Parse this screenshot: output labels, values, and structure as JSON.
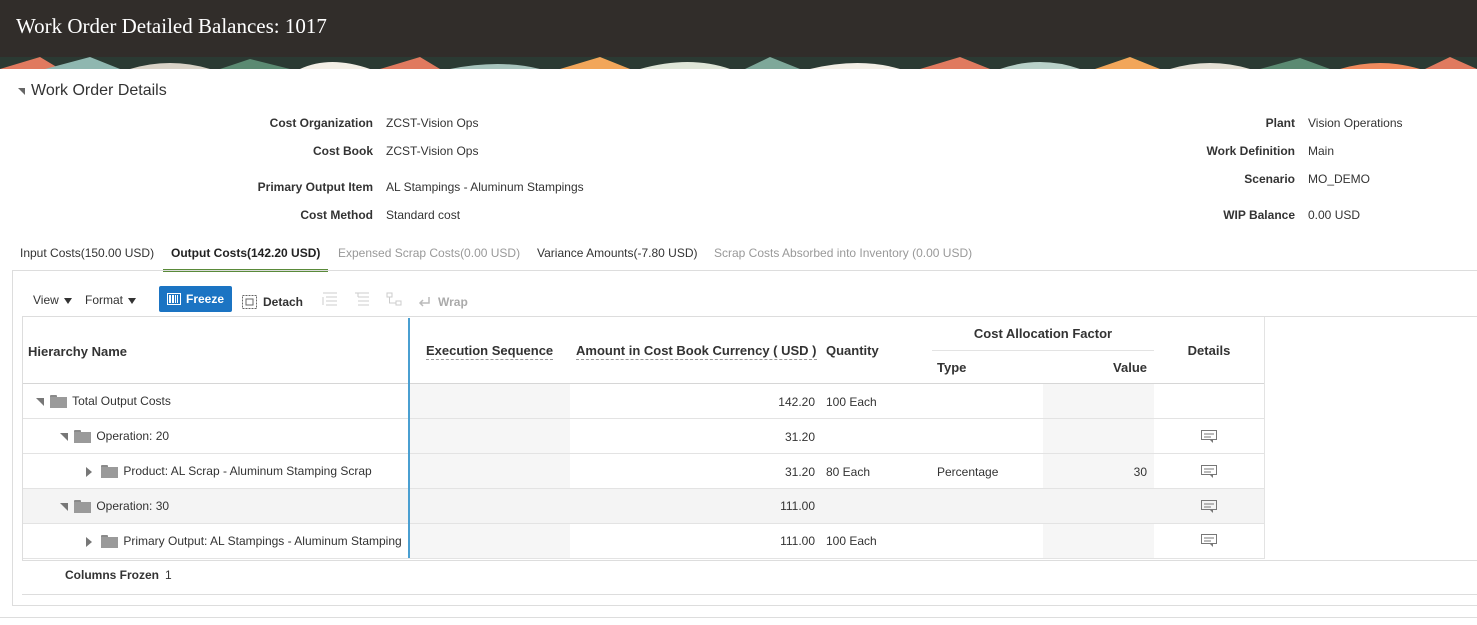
{
  "page": {
    "title": "Work Order Detailed Balances: 1017"
  },
  "section": {
    "title": "Work Order Details"
  },
  "details": {
    "cost_org_label": "Cost Organization",
    "cost_org_value": "ZCST-Vision Ops",
    "cost_book_label": "Cost Book",
    "cost_book_value": "ZCST-Vision Ops",
    "primary_output_label": "Primary Output Item",
    "primary_output_value": "AL Stampings - Aluminum Stampings",
    "cost_method_label": "Cost Method",
    "cost_method_value": "Standard cost",
    "plant_label": "Plant",
    "plant_value": "Vision Operations",
    "work_def_label": "Work Definition",
    "work_def_value": "Main",
    "scenario_label": "Scenario",
    "scenario_value": "MO_DEMO",
    "wip_label": "WIP Balance",
    "wip_value": "0.00 USD"
  },
  "tabs": [
    {
      "label": "Input Costs(150.00 USD)",
      "state": "normal"
    },
    {
      "label": "Output Costs(142.20 USD)",
      "state": "active"
    },
    {
      "label": "Expensed Scrap Costs(0.00 USD)",
      "state": "disabled"
    },
    {
      "label": "Variance Amounts(-7.80 USD)",
      "state": "normal"
    },
    {
      "label": "Scrap Costs Absorbed into Inventory (0.00 USD)",
      "state": "disabled"
    }
  ],
  "toolbar": {
    "view": "View",
    "format": "Format",
    "freeze": "Freeze",
    "detach": "Detach",
    "wrap": "Wrap"
  },
  "columns": {
    "hierarchy": "Hierarchy Name",
    "exec_seq": "Execution Sequence",
    "amount": "Amount in Cost Book Currency ( USD )",
    "quantity": "Quantity",
    "alloc_group": "Cost Allocation Factor",
    "type": "Type",
    "value": "Value",
    "details": "Details"
  },
  "rows": [
    {
      "name": "Total Output Costs",
      "amount": "142.20",
      "quantity": "100 Each",
      "type": "",
      "value": "",
      "has_details": false
    },
    {
      "name": "Operation: 20",
      "amount": "31.20",
      "quantity": "",
      "type": "",
      "value": "",
      "has_details": true
    },
    {
      "name": "Product: AL Scrap - Aluminum Stamping Scrap",
      "amount": "31.20",
      "quantity": "80 Each",
      "type": "Percentage",
      "value": "30",
      "has_details": true
    },
    {
      "name": "Operation: 30",
      "amount": "111.00",
      "quantity": "",
      "type": "",
      "value": "",
      "has_details": true
    },
    {
      "name": "Primary Output: AL Stampings - Aluminum Stamping",
      "amount": "111.00",
      "quantity": "100 Each",
      "type": "",
      "value": "",
      "has_details": true
    }
  ],
  "footer": {
    "frozen_label": "Columns Frozen",
    "frozen_value": "1"
  },
  "colors": {
    "header_bg": "#312d2a",
    "freeze_btn": "#1b74c3",
    "active_tab": "#5a8a3a",
    "frozen_line": "#4a9fd1"
  }
}
